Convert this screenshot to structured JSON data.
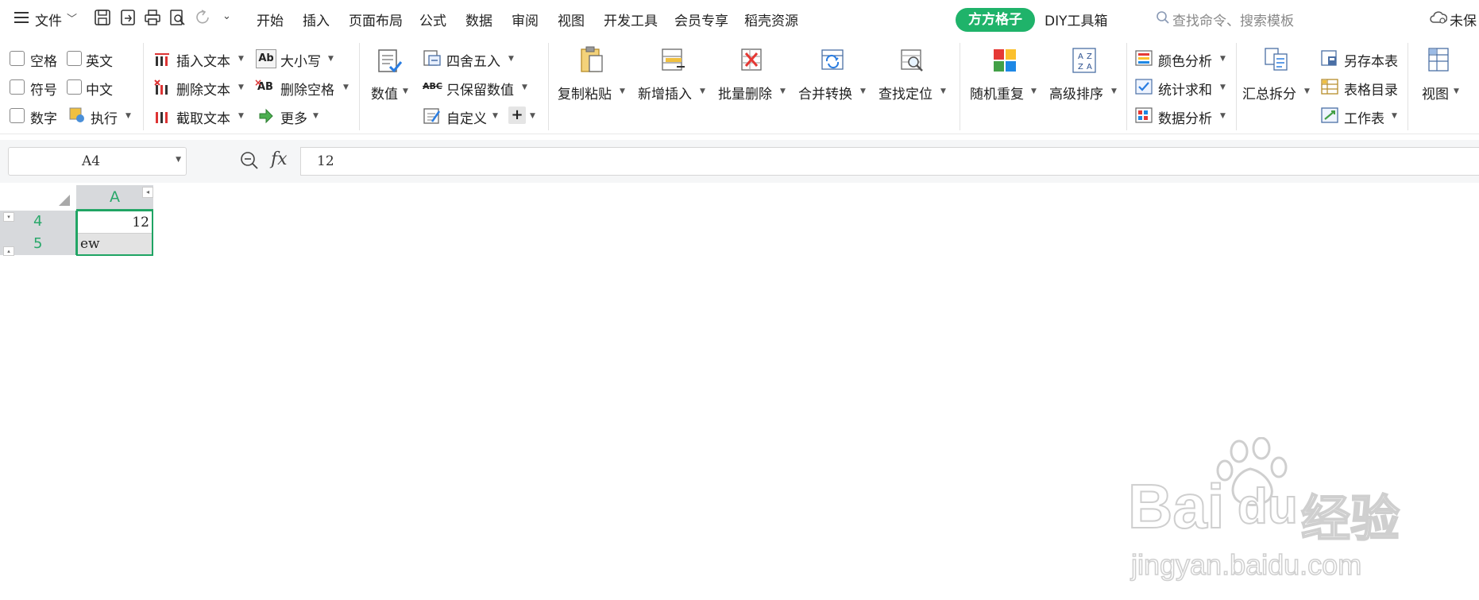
{
  "menu": {
    "file_label": "文件",
    "tabs": [
      "开始",
      "插入",
      "页面布局",
      "公式",
      "数据",
      "审阅",
      "视图",
      "开发工具",
      "会员专享",
      "稻壳资源",
      "方方格子",
      "DIY工具箱"
    ],
    "search_placeholder": "查找命令、搜索模板",
    "unsaved_label": "未保"
  },
  "ribbon": {
    "checkboxes": [
      "空格",
      "英文",
      "符号",
      "中文",
      "数字"
    ],
    "run_label": "执行",
    "insert_text": "插入文本",
    "delete_text": "删除文本",
    "extract_text": "截取文本",
    "case_label": "大小写",
    "delete_space": "删除空格",
    "more_label": "更多",
    "value_label": "数值",
    "round_label": "四舍五入",
    "keep_value": "只保留数值",
    "custom_label": "自定义",
    "copy_paste": "复制粘贴",
    "new_insert": "新增插入",
    "batch_delete": "批量删除",
    "merge_convert": "合并转换",
    "find_locate": "查找定位",
    "random_repeat": "随机重复",
    "advanced_sort": "高级排序",
    "color_analysis": "颜色分析",
    "stat_sum": "统计求和",
    "data_analysis": "数据分析",
    "summary_split": "汇总拆分",
    "save_as_sheet": "另存本表",
    "sheet_index": "表格目录",
    "worksheet": "工作表",
    "view_label": "视图"
  },
  "formula_bar": {
    "cell_ref": "A4",
    "fx_label": "fx",
    "formula_value": "12"
  },
  "sheet": {
    "column_header": "A",
    "rows": [
      {
        "row": "4",
        "value": "12"
      },
      {
        "row": "5",
        "value": "ew"
      }
    ]
  },
  "watermark": {
    "brand": "Bai",
    "brand2": "du",
    "brand_cn": "经验",
    "url": "jingyan.baidu.com"
  },
  "colors": {
    "accent_green": "#1fb36a",
    "selected_border": "#1fa463",
    "header_green": "#29a86a"
  }
}
